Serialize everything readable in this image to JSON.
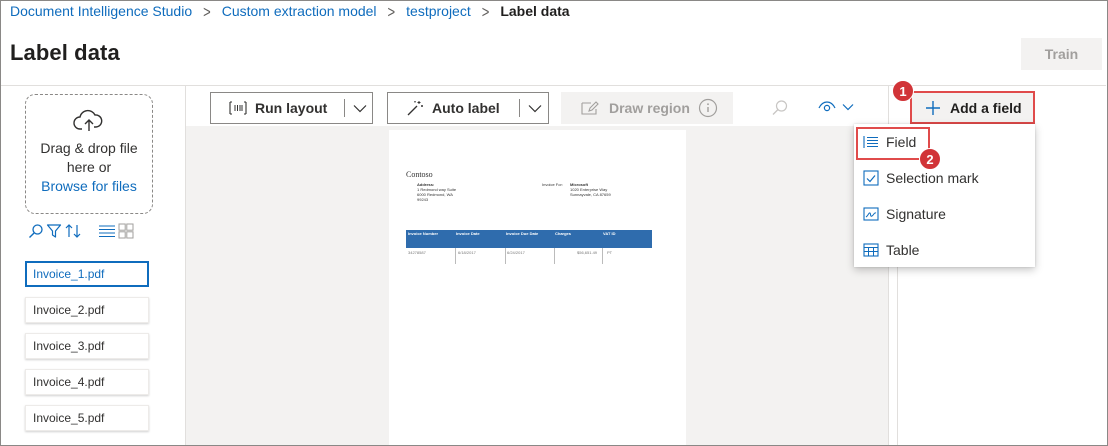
{
  "breadcrumb": [
    "Document Intelligence Studio",
    "Custom extraction model",
    "testproject",
    "Label data"
  ],
  "page": {
    "title": "Label data",
    "train_label": "Train"
  },
  "upload": {
    "line1": "Drag & drop file",
    "line2": "here or",
    "browse_label": "Browse for files"
  },
  "files": [
    "Invoice_1.pdf",
    "Invoice_2.pdf",
    "Invoice_3.pdf",
    "Invoice_4.pdf",
    "Invoice_5.pdf"
  ],
  "toolbar": {
    "run_layout": "Run layout",
    "auto_label": "Auto label",
    "draw_region": "Draw region"
  },
  "add_field": {
    "label": "Add a field",
    "step": "1"
  },
  "menu": {
    "step": "2",
    "items": [
      {
        "label": "Field",
        "icon": "field-list-icon"
      },
      {
        "label": "Selection mark",
        "icon": "checkbox-icon"
      },
      {
        "label": "Signature",
        "icon": "signature-icon"
      },
      {
        "label": "Table",
        "icon": "table-icon"
      }
    ]
  },
  "document": {
    "company": "Contoso",
    "address_label": "Address:",
    "address_lines": [
      "1 Redmond way Suite",
      "6000 Redmond, WA",
      "99243"
    ],
    "invoice_for_label": "Invoice For:",
    "invoice_for_name": "Microsoft",
    "invoice_for_lines": [
      "1020 Enterprise Way",
      "Sunnayvale, CA 87659"
    ],
    "table_headers": [
      "Invoice Number",
      "Invoice Date",
      "Invoice Due Date",
      "Charges",
      "VAT ID"
    ],
    "table_row": [
      "34278587",
      "6/18/2017",
      "6/24/2017",
      "$56,651.49",
      "PT"
    ]
  },
  "colors": {
    "accent": "#0f6cbd",
    "highlight": "#e04b4b",
    "badge": "#d13438",
    "table_header": "#2f6cad"
  }
}
